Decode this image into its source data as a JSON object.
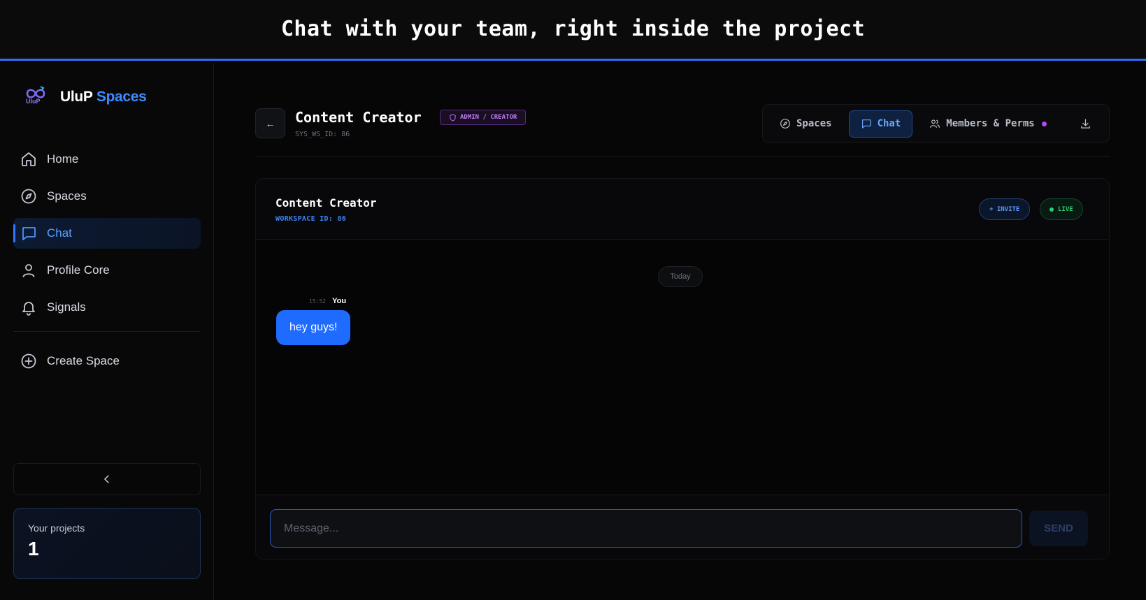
{
  "banner": {
    "text": "Chat with your team, right inside the project"
  },
  "brand": {
    "logo_text": "UluP",
    "name_part1": "UluP",
    "name_part2": "Spaces"
  },
  "sidebar": {
    "items": [
      {
        "label": "Home",
        "icon": "home-icon"
      },
      {
        "label": "Spaces",
        "icon": "compass-icon"
      },
      {
        "label": "Chat",
        "icon": "chat-icon",
        "active": true
      },
      {
        "label": "Profile Core",
        "icon": "user-icon"
      },
      {
        "label": "Signals",
        "icon": "bell-icon"
      }
    ],
    "create_label": "Create Space",
    "collapse_icon": "chevron-left-icon",
    "projects": {
      "label": "Your projects",
      "count": "1"
    }
  },
  "header": {
    "back_label": "←",
    "title": "Content Creator",
    "role_badge": "ADMIN / CREATOR",
    "sys_id": "SYS_WS_ID: 86",
    "tabs": [
      {
        "label": "Spaces",
        "icon": "compass-icon"
      },
      {
        "label": "Chat",
        "icon": "chat-icon",
        "active": true
      },
      {
        "label": "Members & Perms",
        "icon": "users-icon"
      }
    ],
    "download_icon": "download-icon"
  },
  "chat": {
    "title": "Content Creator",
    "workspace_id": "WORKSPACE ID: 86",
    "invite_label": "+ INVITE",
    "live_label": "LIVE",
    "date_label": "Today",
    "messages": [
      {
        "time": "15:52",
        "author": "You",
        "text": "hey guys!"
      }
    ],
    "input_placeholder": "Message...",
    "send_label": "SEND"
  },
  "colors": {
    "accent": "#2f6df2",
    "bubble": "#1f6bff",
    "live": "#2ecc71",
    "role": "#c17cf2"
  }
}
